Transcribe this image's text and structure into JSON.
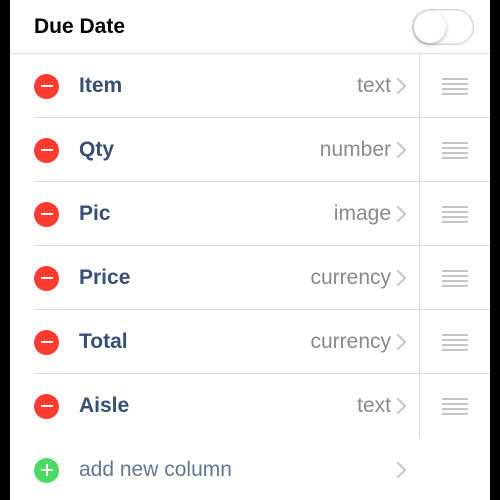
{
  "header": {
    "title": "Due Date",
    "toggle_on": false
  },
  "columns": [
    {
      "name": "Item",
      "type": "text"
    },
    {
      "name": "Qty",
      "type": "number"
    },
    {
      "name": "Pic",
      "type": "image"
    },
    {
      "name": "Price",
      "type": "currency"
    },
    {
      "name": "Total",
      "type": "currency"
    },
    {
      "name": "Aisle",
      "type": "text"
    }
  ],
  "add_row": {
    "label": "add new column"
  }
}
